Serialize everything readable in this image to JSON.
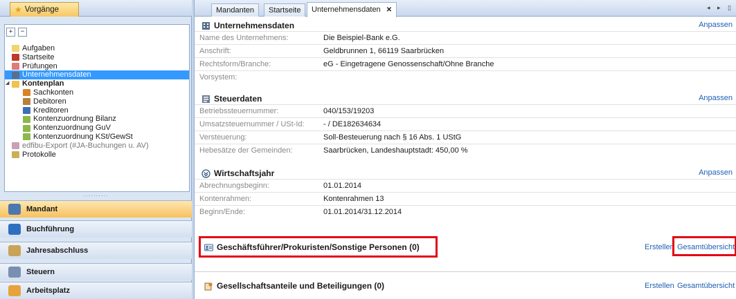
{
  "left": {
    "tab_label": "Vorgänge",
    "tree_toolbar": {
      "expand": "+",
      "collapse": "−"
    },
    "tree": [
      {
        "label": "Aufgaben",
        "level": 0,
        "icon_color": "#f0d470",
        "icon": "folder-icon"
      },
      {
        "label": "Startseite",
        "level": 0,
        "icon_color": "#c0392b",
        "icon": "home-icon"
      },
      {
        "label": "Prüfungen",
        "level": 0,
        "icon_color": "#e07b7b",
        "icon": "checklist-icon"
      },
      {
        "label": "Unternehmensdaten",
        "level": 0,
        "icon_color": "#5a6f8c",
        "icon": "company-icon",
        "selected": true
      },
      {
        "label": "Kontenplan",
        "level": 0,
        "icon_color": "#f0c24f",
        "icon": "folder-icon",
        "bold": true,
        "expanded": true
      },
      {
        "label": "Sachkonten",
        "level": 1,
        "icon_color": "#d9822b",
        "icon": "ledger-icon"
      },
      {
        "label": "Debitoren",
        "level": 1,
        "icon_color": "#b5823a",
        "icon": "person-icon"
      },
      {
        "label": "Kreditoren",
        "level": 1,
        "icon_color": "#3d6fb6",
        "icon": "person-icon"
      },
      {
        "label": "Kontenzuordnung Bilanz",
        "level": 1,
        "icon_color": "#8cb84a",
        "icon": "assign-icon"
      },
      {
        "label": "Kontenzuordnung GuV",
        "level": 1,
        "icon_color": "#8cb84a",
        "icon": "assign-icon"
      },
      {
        "label": "Kontenzuordnung KSt/GewSt",
        "level": 1,
        "icon_color": "#8cb84a",
        "icon": "assign-icon"
      },
      {
        "label": "edfibu-Export (#JA-Buchungen u. AV)",
        "level": 0,
        "icon_color": "#c8a0b8",
        "icon": "export-icon",
        "muted": true
      },
      {
        "label": "Protokolle",
        "level": 0,
        "icon_color": "#c9b15a",
        "icon": "log-icon"
      }
    ],
    "splitter": "··········",
    "nav": [
      {
        "label": "Mandant",
        "icon_color": "#4c78b0",
        "icon": "grid-icon",
        "active": true
      },
      {
        "label": "Buchführung",
        "icon_color": "#2f6fc0",
        "icon": "book-icon"
      },
      {
        "label": "Jahresabschluss",
        "icon_color": "#c9a35a",
        "icon": "people-icon"
      },
      {
        "label": "Steuern",
        "icon_color": "#7a8fb0",
        "icon": "tax-icon"
      },
      {
        "label": "Arbeitsplatz",
        "icon_color": "#e8a23b",
        "icon": "tools-icon"
      }
    ]
  },
  "tabs": [
    {
      "label": "Mandanten"
    },
    {
      "label": "Startseite"
    },
    {
      "label": "Unternehmensdaten",
      "close": "✕",
      "active": true
    }
  ],
  "tab_nav": "◂ ▸ ▯",
  "sections": {
    "unternehmen": {
      "title": "Unternehmensdaten",
      "action": "Anpassen",
      "rows": [
        {
          "label": "Name des Unternehmens:",
          "value": "Die Beispiel-Bank e.G."
        },
        {
          "label": "Anschrift:",
          "value": "Geldbrunnen 1, 66119 Saarbrücken"
        },
        {
          "label": "Rechtsform/Branche:",
          "value": "eG - Eingetragene Genossenschaft/Ohne Branche"
        },
        {
          "label": "Vorsystem:",
          "value": ""
        }
      ]
    },
    "steuer": {
      "title": "Steuerdaten",
      "action": "Anpassen",
      "rows": [
        {
          "label": "Betriebssteuernummer:",
          "value": "040/153/19203"
        },
        {
          "label": "Umsatzsteuernummer / USt-Id:",
          "value": "- / DE182634634"
        },
        {
          "label": "Versteuerung:",
          "value": "Soll-Besteuerung nach § 16 Abs. 1 UStG"
        },
        {
          "label": "Hebesätze der Gemeinden:",
          "value": "Saarbrücken, Landeshauptstadt: 450,00 %"
        }
      ]
    },
    "wirtschaftsjahr": {
      "title": "Wirtschaftsjahr",
      "action": "Anpassen",
      "rows": [
        {
          "label": "Abrechnungsbeginn:",
          "value": "01.01.2014"
        },
        {
          "label": "Kontenrahmen:",
          "value": "Kontenrahmen 13"
        },
        {
          "label": "Beginn/Ende:",
          "value": "01.01.2014/31.12.2014"
        }
      ]
    },
    "personen": {
      "title": "Geschäftsführer/Prokuristen/Sonstige Personen (0)",
      "create": "Erstellen",
      "overview": "Gesamtübersicht"
    },
    "anteile": {
      "title": "Gesellschaftsanteile und Beteiligungen (0)",
      "create": "Erstellen",
      "overview": "Gesamtübersicht"
    }
  },
  "colors": {
    "link": "#1f5fb4",
    "highlight": "#e30613",
    "selection": "#3399ff"
  }
}
